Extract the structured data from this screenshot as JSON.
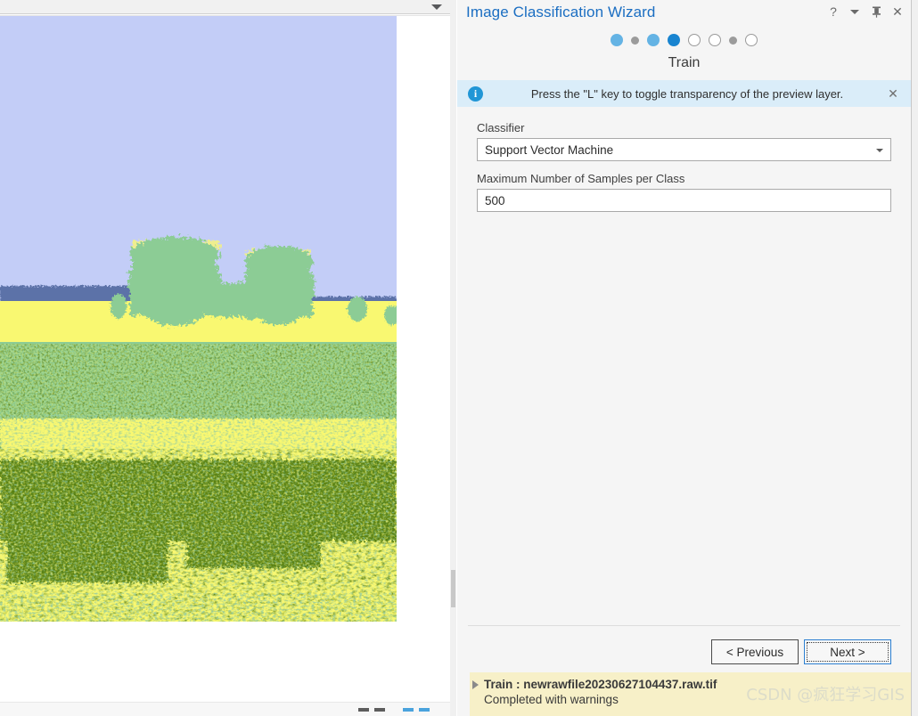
{
  "window": {
    "title": "Image Classification Wizard",
    "controls": [
      {
        "name": "help-icon",
        "glyph": "?"
      },
      {
        "name": "chevron-down-icon",
        "glyph": ""
      },
      {
        "name": "pin-icon",
        "glyph": "⊥"
      },
      {
        "name": "close-icon",
        "glyph": "✕"
      }
    ]
  },
  "steps": {
    "current_label": "Train",
    "dots": [
      {
        "state": "done",
        "size": "big"
      },
      {
        "state": "sep",
        "size": "small"
      },
      {
        "state": "done",
        "size": "big"
      },
      {
        "state": "current",
        "size": "big"
      },
      {
        "state": "todo",
        "size": "big"
      },
      {
        "state": "todo",
        "size": "big"
      },
      {
        "state": "sep",
        "size": "small"
      },
      {
        "state": "todo",
        "size": "big"
      }
    ]
  },
  "info": {
    "icon": "info-icon",
    "message": "Press the \"L\" key to toggle transparency of the preview layer.",
    "close_glyph": "✕"
  },
  "form": {
    "classifier_label": "Classifier",
    "classifier_value": "Support Vector Machine",
    "max_samples_label": "Maximum Number of Samples per Class",
    "max_samples_value": "500"
  },
  "footer": {
    "previous_label": "< Previous",
    "next_label": "Next >"
  },
  "status": {
    "title": "Train : newrawfile20230627104437.raw.tif",
    "subtitle": "Completed with warnings",
    "watermark": "CSDN @疯狂学习GIS"
  },
  "map": {
    "toolbar_caret": "chevron-down-icon"
  },
  "colors": {
    "accent_blue": "#1b6ec2",
    "step_current": "#1884d0",
    "step_done": "#64b3e4",
    "info_bg": "#daedf9",
    "status_bg": "#f7f0c8",
    "class_sky": "#c3cdf7",
    "class_water": "#5b72a8",
    "class_yellow": "#f9f871",
    "class_green_light": "#8ccc95",
    "class_green_sage": "#8fc9a4",
    "class_green_dark": "#4f7a10"
  }
}
